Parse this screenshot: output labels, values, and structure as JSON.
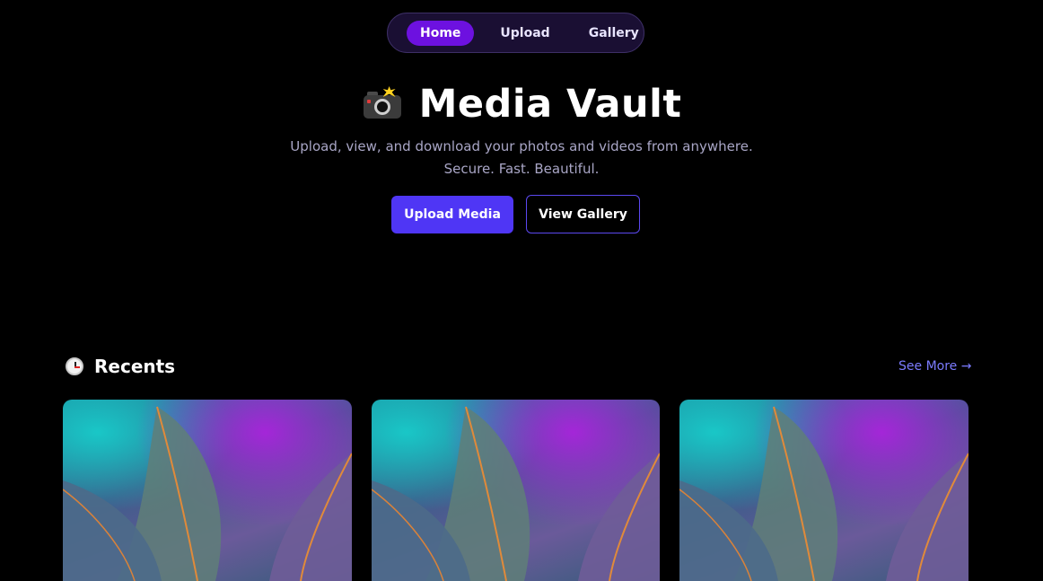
{
  "nav": {
    "items": [
      {
        "label": "Home",
        "active": true
      },
      {
        "label": "Upload",
        "active": false
      },
      {
        "label": "Gallery",
        "active": false
      }
    ]
  },
  "hero": {
    "icon": "camera-with-flash-icon",
    "title": "Media Vault",
    "subtitle_line1": "Upload, view, and download your photos and videos from anywhere.",
    "subtitle_line2": "Secure. Fast. Beautiful.",
    "primary_button": "Upload Media",
    "secondary_button": "View Gallery"
  },
  "recents": {
    "icon": "clock-icon",
    "title": "Recents",
    "see_more": "See More →",
    "cards": [
      {
        "image": "skeleton-leaves-photo"
      },
      {
        "image": "skeleton-leaves-photo"
      },
      {
        "image": "skeleton-leaves-photo"
      }
    ]
  },
  "colors": {
    "background": "#000000",
    "nav_active": "#6d11e0",
    "primary": "#4f36f5",
    "link": "#7b7bff",
    "subtitle": "#a9a6c6"
  }
}
